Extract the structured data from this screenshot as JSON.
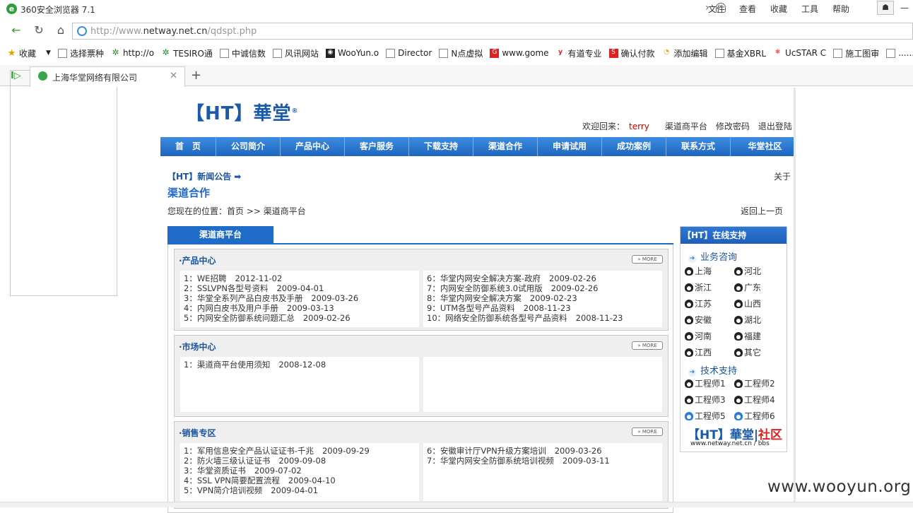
{
  "browser": {
    "title": "360安全浏览器 7.1",
    "menus": [
      "文件",
      "查看",
      "收藏",
      "工具",
      "帮助"
    ],
    "url_prefix": "http://www.",
    "url_host": "netway.net.cn",
    "url_path": "/qdspt.php",
    "favorites_label": "收藏",
    "bookmarks": [
      "选择票种",
      "http://o",
      "TESIRO通",
      "中诚信数",
      "风讯网站",
      "WooYun.o",
      "Director",
      "N点虚拟",
      "www.gome",
      "有道专业",
      "确认付款",
      "添加编辑",
      "基金XBRL",
      "UcSTAR C",
      "施工图审",
      "........"
    ],
    "tab_title": "上海华堂网络有限公司"
  },
  "site": {
    "logo": "【HT】華堂",
    "welcome_prefix": "欢迎回来：",
    "username": "terry",
    "links": [
      "渠道商平台",
      "修改密码",
      "退出登陆"
    ],
    "nav": [
      "首　页",
      "公司简介",
      "产品中心",
      "客户服务",
      "下载支持",
      "渠道合作",
      "申请试用",
      "成功案例",
      "联系方式",
      "华堂社区"
    ],
    "news_label": "【HT】新闻公告",
    "about_text": "关于",
    "page_title": "渠道合作",
    "breadcrumb": "您现在的位置：首页 >> 渠道商平台",
    "back_link": "返回上一页",
    "content_tab": "渠道商平台",
    "more_label": "MORE",
    "sections": [
      {
        "title": "·产品中心",
        "left": [
          {
            "t": "1：WE招聘",
            "d": "2012-11-02"
          },
          {
            "t": "2：SSLVPN各型号资料",
            "d": "2009-04-01"
          },
          {
            "t": "3：华堂全系列产品白皮书及手册",
            "d": "2009-03-26"
          },
          {
            "t": "4：内网白皮书及用户手册",
            "d": "2009-03-13"
          },
          {
            "t": "5：内网安全防御系统问题汇总",
            "d": "2009-02-26"
          }
        ],
        "right": [
          {
            "t": "6：华堂内网安全解决方案-政府",
            "d": "2009-02-26"
          },
          {
            "t": "7：内网安全防御系统3.0试用版",
            "d": "2009-02-26"
          },
          {
            "t": "8：华堂内网安全解决方案",
            "d": "2009-02-23"
          },
          {
            "t": "9：UTM各型号产品资料",
            "d": "2008-11-23"
          },
          {
            "t": "10：网络安全防御系统各型号产品资料",
            "d": "2008-11-23"
          }
        ]
      },
      {
        "title": "·市场中心",
        "left": [
          {
            "t": "1：渠道商平台使用须知",
            "d": "2008-12-08"
          }
        ],
        "right": []
      },
      {
        "title": "·销售专区",
        "left": [
          {
            "t": "1：军用信息安全产品认证证书-千兆",
            "d": "2009-09-29"
          },
          {
            "t": "2：防火墙三级认证证书",
            "d": "2009-09-08"
          },
          {
            "t": "3：华堂资质证书",
            "d": "2009-07-02"
          },
          {
            "t": "4：SSL VPN简要配置流程",
            "d": "2009-04-10"
          },
          {
            "t": "5：VPN简介培训视频",
            "d": "2009-04-01"
          }
        ],
        "right": [
          {
            "t": "6：安徽审计厅VPN升级方案培训",
            "d": "2009-03-26"
          },
          {
            "t": "7：华堂内网安全防御系统培训视频",
            "d": "2009-03-11"
          }
        ]
      }
    ],
    "support": {
      "title": "【HT】在线支持",
      "business_label": "业务咨询",
      "business": [
        "上海",
        "河北",
        "浙江",
        "广东",
        "江苏",
        "山西",
        "安徽",
        "湖北",
        "河南",
        "福建",
        "江西",
        "其它"
      ],
      "tech_label": "技术支持",
      "tech": [
        "工程师1",
        "工程师2",
        "工程师3",
        "工程师4",
        "工程师5",
        "工程师6"
      ],
      "bbs_logo_a": "【HT】華堂",
      "bbs_logo_b": "社区",
      "bbs_url": "www.netway.net.cn / bbs"
    }
  },
  "watermark": "www.wooyun.org"
}
